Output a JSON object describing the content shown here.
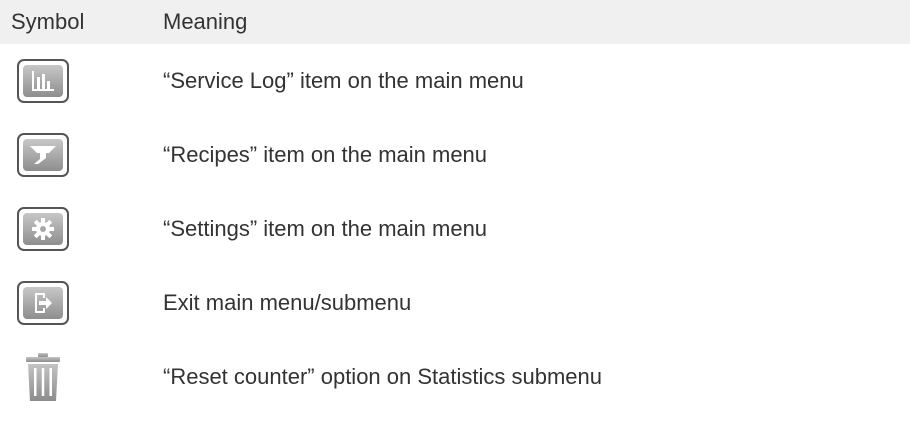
{
  "table": {
    "header": {
      "symbol": "Symbol",
      "meaning": "Meaning"
    },
    "rows": [
      {
        "icon": "bar-chart-icon",
        "meaning": "“Service Log” item on the main menu"
      },
      {
        "icon": "funnel-icon",
        "meaning": "“Recipes” item on the main menu"
      },
      {
        "icon": "gear-icon",
        "meaning": "“Settings” item on the main menu"
      },
      {
        "icon": "exit-icon",
        "meaning": "Exit main menu/submenu"
      },
      {
        "icon": "trash-icon",
        "meaning": "“Reset counter” option on Statistics submenu"
      }
    ]
  },
  "colors": {
    "header_bg": "#f0f0f0",
    "text": "#333333",
    "icon_border": "#555555",
    "icon_gradient_top": "#c7c7c7",
    "icon_gradient_bottom": "#8e8e8e"
  }
}
